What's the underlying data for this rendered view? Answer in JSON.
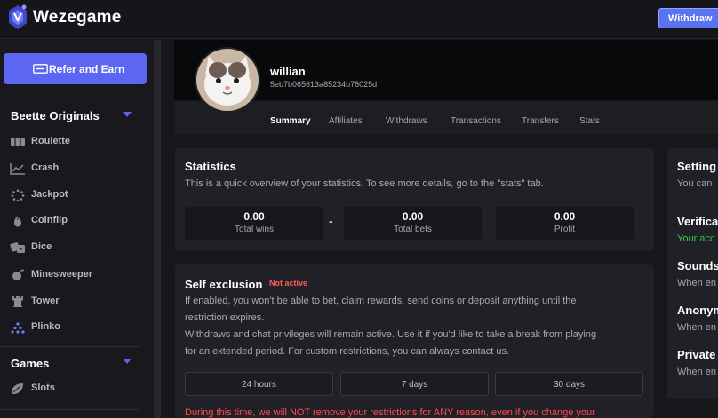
{
  "brand": {
    "name": "Wezegame"
  },
  "header": {
    "withdraw_label": "Withdraw"
  },
  "sidebar": {
    "refer_label": "Refer and Earn",
    "originals_title": "Beette Originals",
    "originals": [
      {
        "label": "Roulette",
        "icon": "roulette-icon"
      },
      {
        "label": "Crash",
        "icon": "crash-chart-icon"
      },
      {
        "label": "Jackpot",
        "icon": "jackpot-icon"
      },
      {
        "label": "Coinflip",
        "icon": "coinflip-icon"
      },
      {
        "label": "Dice",
        "icon": "dice-icon"
      },
      {
        "label": "Minesweeper",
        "icon": "mine-icon"
      },
      {
        "label": "Tower",
        "icon": "tower-icon"
      },
      {
        "label": "Plinko",
        "icon": "plinko-icon"
      }
    ],
    "games_title": "Games",
    "games": [
      {
        "label": "Slots",
        "icon": "slots-icon"
      }
    ]
  },
  "profile": {
    "username": "willian",
    "user_id": "5eb7b065613a85234b78025d"
  },
  "tabs": [
    "Summary",
    "Affiliates",
    "Withdraws",
    "Transactions",
    "Transfers",
    "Stats"
  ],
  "active_tab": "Summary",
  "statistics": {
    "title": "Statistics",
    "description": "This is a quick overview of your statistics. To see more details, go to the \"stats\" tab.",
    "separator": "-",
    "items": [
      {
        "value": "0.00",
        "label": "Total wins"
      },
      {
        "value": "0.00",
        "label": "Total bets"
      },
      {
        "value": "0.00",
        "label": "Profit"
      }
    ]
  },
  "self_exclusion": {
    "title": "Self exclusion",
    "status": "Not active",
    "line1": "If enabled, you won't be able to bet, claim rewards, send coins or deposit anything until the",
    "line2": "restriction expires.",
    "line3": "Withdraws and chat privileges will remain active. Use it if you'd like to take a break from playing",
    "line4": "for an extended period. For custom restrictions, you can always contact us.",
    "durations": [
      "24 hours",
      "7 days",
      "30 days"
    ],
    "warning": "During this time, we will NOT remove your restrictions for ANY reason, even if you change your"
  },
  "settings": {
    "title": "Setting",
    "subtitle": "You can",
    "items": [
      {
        "title": "Verifica",
        "sub": "Your acc"
      },
      {
        "title": "Sounds",
        "sub": "When en"
      },
      {
        "title": "Anonym",
        "sub": "When en"
      },
      {
        "title": "Private",
        "sub": "When en"
      }
    ]
  },
  "colors": {
    "accent": "#5b66f2",
    "danger": "#ff4d4d",
    "success": "#2bd34a",
    "background": "#17171b",
    "card": "#202026"
  }
}
